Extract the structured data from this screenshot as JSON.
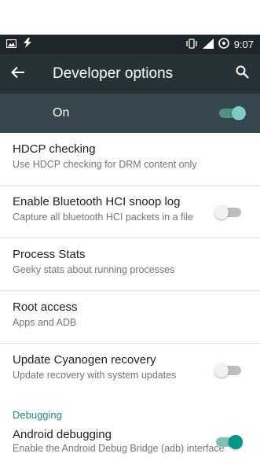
{
  "status_bar": {
    "time": "9:07",
    "icons": [
      "image-icon",
      "flash-icon",
      "vibrate-icon",
      "signal-icon",
      "data-saver-icon"
    ]
  },
  "app_bar": {
    "title": "Developer options",
    "back_icon": "arrow-back-icon",
    "search_icon": "search-icon"
  },
  "master": {
    "label": "On",
    "enabled": true
  },
  "items": [
    {
      "title": "HDCP checking",
      "summary": "Use HDCP checking for DRM content only"
    },
    {
      "title": "Enable Bluetooth HCI snoop log",
      "summary": "Capture all bluetooth HCI packets in a file",
      "switch": false
    },
    {
      "title": "Process Stats",
      "summary": "Geeky stats about running processes"
    },
    {
      "title": "Root access",
      "summary": "Apps and ADB"
    },
    {
      "title": "Update Cyanogen recovery",
      "summary": "Update recovery with system updates",
      "switch": false
    }
  ],
  "category": {
    "label": "Debugging"
  },
  "debug_items": [
    {
      "title": "Android debugging",
      "summary": "Enable the Android Debug Bridge (adb) interface",
      "switch": true
    }
  ],
  "colors": {
    "app_bar": "#263238",
    "master_bar": "#37474f",
    "accent": "#009688",
    "category": "#26877c"
  }
}
